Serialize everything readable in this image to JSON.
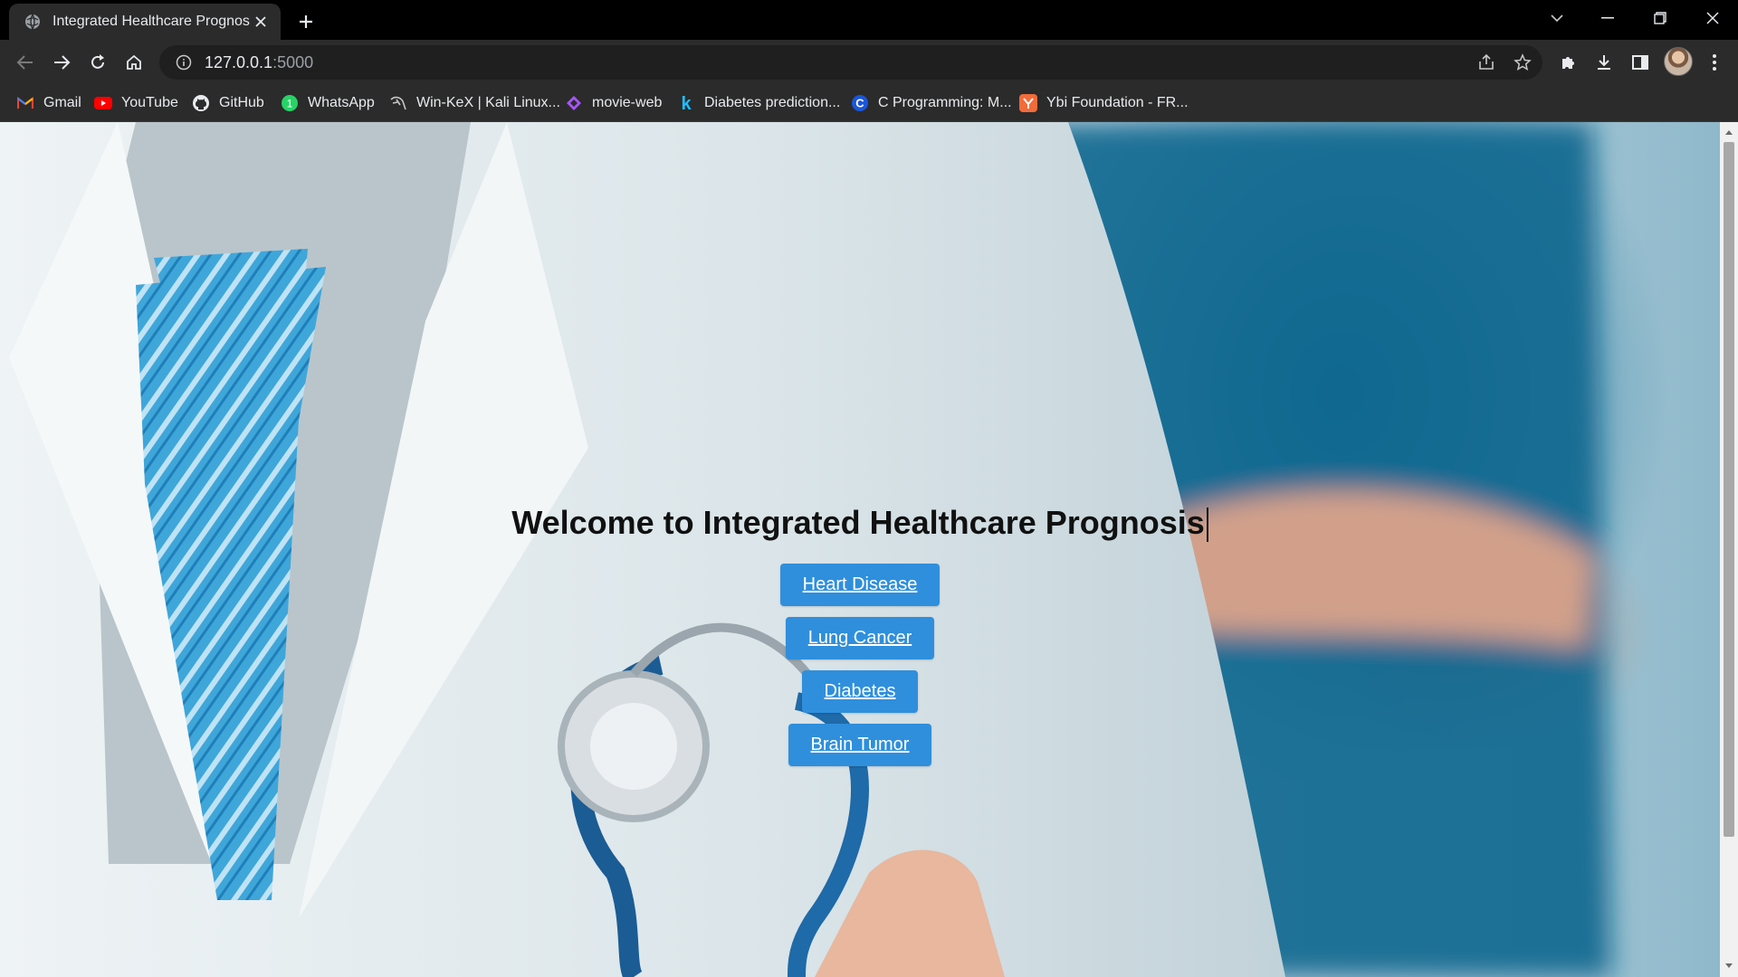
{
  "browser": {
    "tab": {
      "title": "Integrated Healthcare Prognosis",
      "favicon": "globe-icon"
    },
    "address": {
      "host": "127.0.0.1",
      "port": ":5000"
    },
    "bookmarks": [
      {
        "label": "Gmail",
        "icon": "gmail-icon"
      },
      {
        "label": "YouTube",
        "icon": "youtube-icon"
      },
      {
        "label": "GitHub",
        "icon": "github-icon"
      },
      {
        "label": "WhatsApp",
        "icon": "whatsapp-icon"
      },
      {
        "label": "Win-KeX | Kali Linux...",
        "icon": "kali-icon"
      },
      {
        "label": "movie-web",
        "icon": "movie-web-icon"
      },
      {
        "label": "Diabetes prediction...",
        "icon": "kaggle-icon"
      },
      {
        "label": "C Programming: M...",
        "icon": "c-programming-icon"
      },
      {
        "label": "Ybi Foundation - FR...",
        "icon": "ybi-icon"
      }
    ]
  },
  "page": {
    "heading": "Welcome to Integrated Healthcare Prognosis",
    "buttons": [
      {
        "label": "Heart Disease"
      },
      {
        "label": "Lung Cancer"
      },
      {
        "label": "Diabetes"
      },
      {
        "label": "Brain Tumor"
      }
    ]
  },
  "colors": {
    "button_bg": "#2f8fdc",
    "chrome_dark": "#2b2b2b",
    "tab_strip": "#000000"
  }
}
